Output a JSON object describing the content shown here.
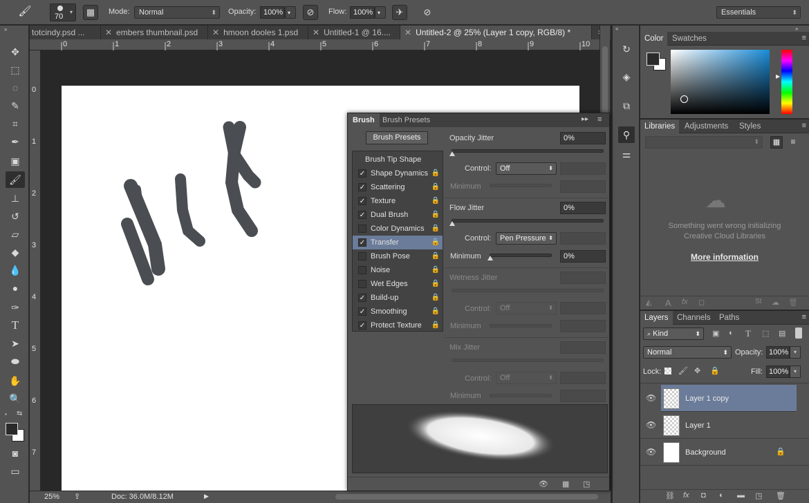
{
  "options_bar": {
    "brush_size": "70",
    "mode_label": "Mode:",
    "mode_value": "Normal",
    "opacity_label": "Opacity:",
    "opacity_value": "100%",
    "flow_label": "Flow:",
    "flow_value": "100%",
    "workspace": "Essentials"
  },
  "tabs": [
    {
      "label": "totcindy.psd ..."
    },
    {
      "label": "embers thumbnail.psd"
    },
    {
      "label": "hmoon dooles 1.psd"
    },
    {
      "label": "Untitled-1 @ 16...."
    },
    {
      "label": "Untitled-2 @ 25% (Layer 1 copy, RGB/8) *"
    }
  ],
  "ruler_h": [
    "0",
    "1",
    "2",
    "3",
    "4",
    "5",
    "6",
    "7",
    "8",
    "9",
    "10"
  ],
  "ruler_v": [
    "0",
    "1",
    "2",
    "3",
    "4",
    "5",
    "6",
    "7"
  ],
  "status": {
    "zoom": "25%",
    "doc": "Doc: 36.0M/8.12M"
  },
  "brush_panel": {
    "tab_brush": "Brush",
    "tab_presets": "Brush Presets",
    "presets_button": "Brush Presets",
    "tip_shape": "Brush Tip Shape",
    "items": [
      {
        "label": "Shape Dynamics",
        "checked": "✓"
      },
      {
        "label": "Scattering",
        "checked": "✓"
      },
      {
        "label": "Texture",
        "checked": "✓"
      },
      {
        "label": "Dual Brush",
        "checked": "✓"
      },
      {
        "label": "Color Dynamics",
        "checked": ""
      },
      {
        "label": "Transfer",
        "checked": "✓"
      },
      {
        "label": "Brush Pose",
        "checked": ""
      },
      {
        "label": "Noise",
        "checked": ""
      },
      {
        "label": "Wet Edges",
        "checked": ""
      },
      {
        "label": "Build-up",
        "checked": "✓"
      },
      {
        "label": "Smoothing",
        "checked": "✓"
      },
      {
        "label": "Protect Texture",
        "checked": "✓"
      }
    ],
    "opacity_jitter": {
      "label": "Opacity Jitter",
      "value": "0%",
      "control_label": "Control:",
      "control_value": "Off",
      "minimum_label": "Minimum"
    },
    "flow_jitter": {
      "label": "Flow Jitter",
      "value": "0%",
      "control_label": "Control:",
      "control_value": "Pen Pressure",
      "minimum_label": "Minimum",
      "minimum_value": "0%"
    },
    "wetness_jitter": {
      "label": "Wetness Jitter",
      "control_label": "Control:",
      "control_value": "Off",
      "minimum_label": "Minimum"
    },
    "mix_jitter": {
      "label": "Mix Jitter",
      "control_label": "Control:",
      "control_value": "Off",
      "minimum_label": "Minimum"
    }
  },
  "color_panel": {
    "tab_color": "Color",
    "tab_swatches": "Swatches"
  },
  "libraries_panel": {
    "tab_libraries": "Libraries",
    "tab_adjustments": "Adjustments",
    "tab_styles": "Styles",
    "error_line1": "Something went wrong initializing",
    "error_line2": "Creative Cloud Libraries",
    "more_info": "More information"
  },
  "layers_panel": {
    "tab_layers": "Layers",
    "tab_channels": "Channels",
    "tab_paths": "Paths",
    "filter_kind": "Kind",
    "blend_mode": "Normal",
    "opacity_label": "Opacity:",
    "opacity_value": "100%",
    "lock_label": "Lock:",
    "fill_label": "Fill:",
    "fill_value": "100%",
    "layers": [
      {
        "name": "Layer 1 copy"
      },
      {
        "name": "Layer 1"
      },
      {
        "name": "Background"
      }
    ]
  },
  "colors": {
    "selection": "#6b7c9a",
    "panel": "#535353",
    "fg_color": "#2a2a2a"
  }
}
